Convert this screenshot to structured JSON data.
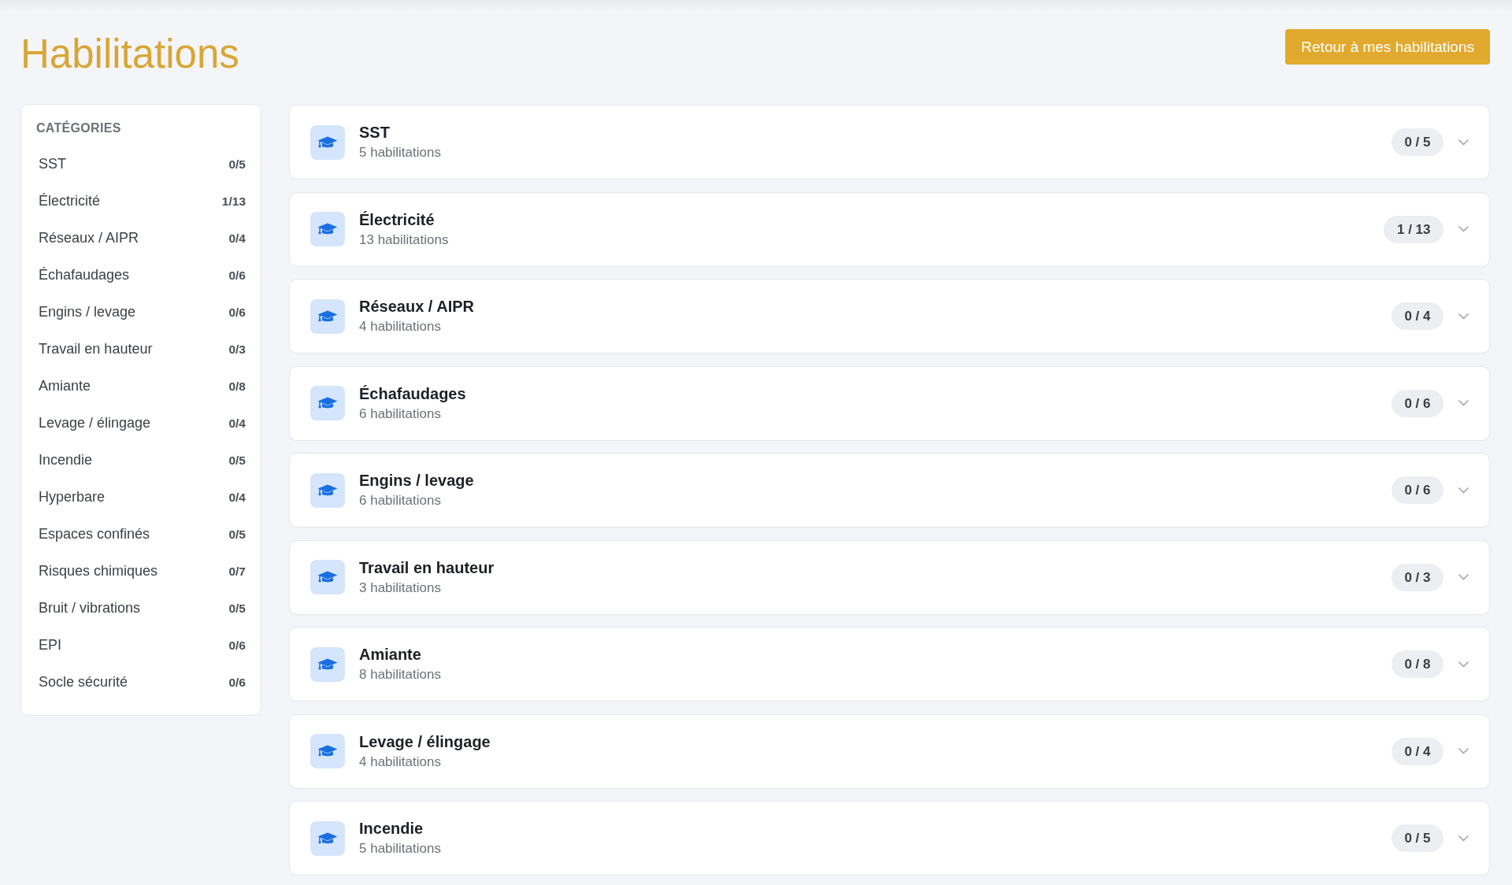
{
  "page": {
    "title": "Habilitations",
    "back_button": "Retour à mes habilitations"
  },
  "sidebar": {
    "heading": "CATÉGORIES",
    "items": [
      {
        "label": "SST",
        "count": "0/5"
      },
      {
        "label": "Électricité",
        "count": "1/13"
      },
      {
        "label": "Réseaux / AIPR",
        "count": "0/4"
      },
      {
        "label": "Échafaudages",
        "count": "0/6"
      },
      {
        "label": "Engins / levage",
        "count": "0/6"
      },
      {
        "label": "Travail en hauteur",
        "count": "0/3"
      },
      {
        "label": "Amiante",
        "count": "0/8"
      },
      {
        "label": "Levage / élingage",
        "count": "0/4"
      },
      {
        "label": "Incendie",
        "count": "0/5"
      },
      {
        "label": "Hyperbare",
        "count": "0/4"
      },
      {
        "label": "Espaces confinés",
        "count": "0/5"
      },
      {
        "label": "Risques chimiques",
        "count": "0/7"
      },
      {
        "label": "Bruit / vibrations",
        "count": "0/5"
      },
      {
        "label": "EPI",
        "count": "0/6"
      },
      {
        "label": "Socle sécurité",
        "count": "0/6"
      }
    ]
  },
  "cards": [
    {
      "title": "SST",
      "subtitle": "5 habilitations",
      "badge": "0 / 5",
      "expanded": false
    },
    {
      "title": "Électricité",
      "subtitle": "13 habilitations",
      "badge": "1 / 13",
      "expanded": false
    },
    {
      "title": "Réseaux / AIPR",
      "subtitle": "4 habilitations",
      "badge": "0 / 4",
      "expanded": false
    },
    {
      "title": "Échafaudages",
      "subtitle": "6 habilitations",
      "badge": "0 / 6",
      "expanded": false
    },
    {
      "title": "Engins / levage",
      "subtitle": "6 habilitations",
      "badge": "0 / 6",
      "expanded": false
    },
    {
      "title": "Travail en hauteur",
      "subtitle": "3 habilitations",
      "badge": "0 / 3",
      "expanded": false
    },
    {
      "title": "Amiante",
      "subtitle": "8 habilitations",
      "badge": "0 / 8",
      "expanded": false
    },
    {
      "title": "Levage / élingage",
      "subtitle": "4 habilitations",
      "badge": "0 / 4",
      "expanded": false
    },
    {
      "title": "Incendie",
      "subtitle": "5 habilitations",
      "badge": "0 / 5",
      "expanded": false
    }
  ]
}
